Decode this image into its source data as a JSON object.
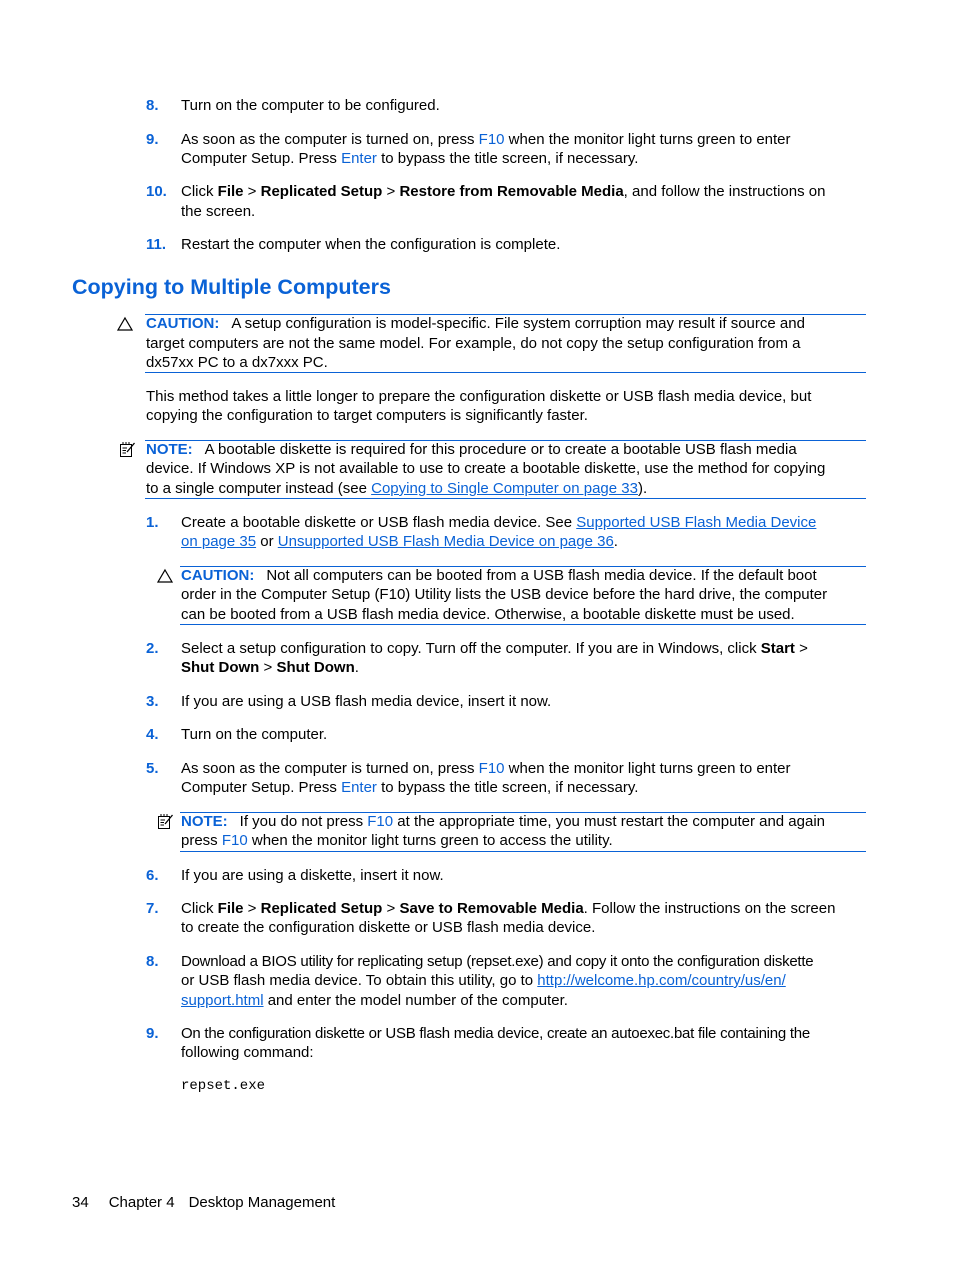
{
  "accent_color": "#0a62d6",
  "top_steps": [
    {
      "num": "8.",
      "text": "Turn on the computer to be configured."
    },
    {
      "num": "9.",
      "l1_a": "As soon as the computer is turned on, press ",
      "l1_key": "F10",
      "l1_b": " when the monitor light turns green to enter",
      "l2_a": "Computer Setup. Press ",
      "l2_key": "Enter",
      "l2_b": " to bypass the title screen, if necessary."
    },
    {
      "num": "10.",
      "l1_a": "Click ",
      "b1": "File",
      "sep1": " > ",
      "b2": "Replicated Setup",
      "sep2": " > ",
      "b3": "Restore from Removable Media",
      "l1_b": ", and follow the instructions on",
      "l2": "the screen."
    },
    {
      "num": "11.",
      "text": "Restart the computer when the configuration is complete."
    }
  ],
  "section": {
    "title": "Copying to Multiple Computers",
    "caution1": {
      "label": "CAUTION:",
      "l1": "A setup configuration is model-specific. File system corruption may result if source and",
      "l2": "target computers are not the same model. For example, do not copy the setup configuration from a",
      "l3": "dx57xx PC to a dx7xxx PC."
    },
    "intro": {
      "l1": "This method takes a little longer to prepare the configuration diskette or USB flash media device, but",
      "l2": "copying the configuration to target computers is significantly faster."
    },
    "note1": {
      "label": "NOTE:",
      "l1": "A bootable diskette is required for this procedure or to create a bootable USB flash media",
      "l2": "device. If Windows XP is not available to use to create a bootable diskette, use the method for copying",
      "l3_a": "to a single computer instead (see ",
      "l3_link": "Copying to Single Computer on page 33",
      "l3_b": ")."
    },
    "steps": [
      {
        "num": "1.",
        "l1_a": "Create a bootable diskette or USB flash media device. See ",
        "link1a": "Supported USB Flash Media Device",
        "link1b": "on page 35",
        "mid": " or ",
        "link2": "Unsupported USB Flash Media Device on page 36",
        "end": "."
      },
      {
        "num": "2.",
        "l1_a": "Select a setup configuration to copy. Turn off the computer. If you are in Windows, click ",
        "b1": "Start",
        "sep1": " >",
        "b2": "Shut Down",
        "sep2": " > ",
        "b3": "Shut Down",
        "end": "."
      },
      {
        "num": "3.",
        "text": "If you are using a USB flash media device, insert it now."
      },
      {
        "num": "4.",
        "text": "Turn on the computer."
      },
      {
        "num": "5.",
        "l1_a": "As soon as the computer is turned on, press ",
        "l1_key": "F10",
        "l1_b": " when the monitor light turns green to enter",
        "l2_a": "Computer Setup. Press ",
        "l2_key": "Enter",
        "l2_b": " to bypass the title screen, if necessary."
      },
      {
        "num": "6.",
        "text": "If you are using a diskette, insert it now."
      },
      {
        "num": "7.",
        "l1_a": "Click ",
        "b1": "File",
        "sep1": " > ",
        "b2": "Replicated Setup",
        "sep2": " > ",
        "b3": "Save to Removable Media",
        "l1_b": ". Follow the instructions on the screen",
        "l2": "to create the configuration diskette or USB flash media device."
      },
      {
        "num": "8.",
        "l1": "Download a BIOS utility for replicating setup (repset.exe) and copy it onto the configuration diskette",
        "l2_a": "or USB flash media device. To obtain this utility, go to ",
        "link_a": "http://welcome.hp.com/country/us/en/",
        "link_b": "support.html",
        "l3_b": " and enter the model number of the computer."
      },
      {
        "num": "9.",
        "l1": "On the configuration diskette or USB flash media device, create an autoexec.bat file containing the",
        "l2": "following command:",
        "code": "repset.exe"
      }
    ],
    "caution2": {
      "label": "CAUTION:",
      "l1": "Not all computers can be booted from a USB flash media device. If the default boot",
      "l2": "order in the Computer Setup (F10) Utility lists the USB device before the hard drive, the computer",
      "l3": "can be booted from a USB flash media device. Otherwise, a bootable diskette must be used."
    },
    "note2": {
      "label": "NOTE:",
      "l1_a": "If you do not press ",
      "l1_key": "F10",
      "l1_b": " at the appropriate time, you must restart the computer and again",
      "l2_a": "press ",
      "l2_key": "F10",
      "l2_b": " when the monitor light turns green to access the utility."
    }
  },
  "footer": {
    "page_number": "34",
    "chapter": "Chapter 4",
    "chapter_title": "Desktop Management"
  }
}
